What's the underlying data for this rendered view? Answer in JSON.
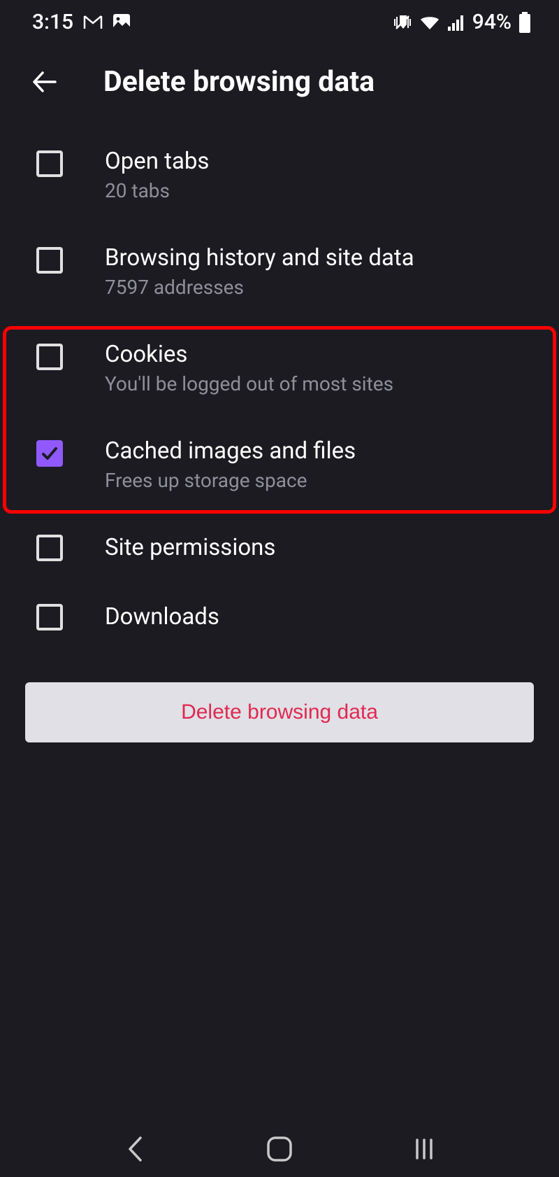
{
  "status": {
    "time": "3:15",
    "battery": "94%"
  },
  "header": {
    "title": "Delete browsing data"
  },
  "items": [
    {
      "label": "Open tabs",
      "sublabel": "20 tabs",
      "checked": false
    },
    {
      "label": "Browsing history and site data",
      "sublabel": "7597 addresses",
      "checked": false
    },
    {
      "label": "Cookies",
      "sublabel": "You'll be logged out of most sites",
      "checked": false
    },
    {
      "label": "Cached images and files",
      "sublabel": "Frees up storage space",
      "checked": true
    },
    {
      "label": "Site permissions",
      "sublabel": "",
      "checked": false
    },
    {
      "label": "Downloads",
      "sublabel": "",
      "checked": false
    }
  ],
  "button": {
    "label": "Delete browsing data"
  }
}
